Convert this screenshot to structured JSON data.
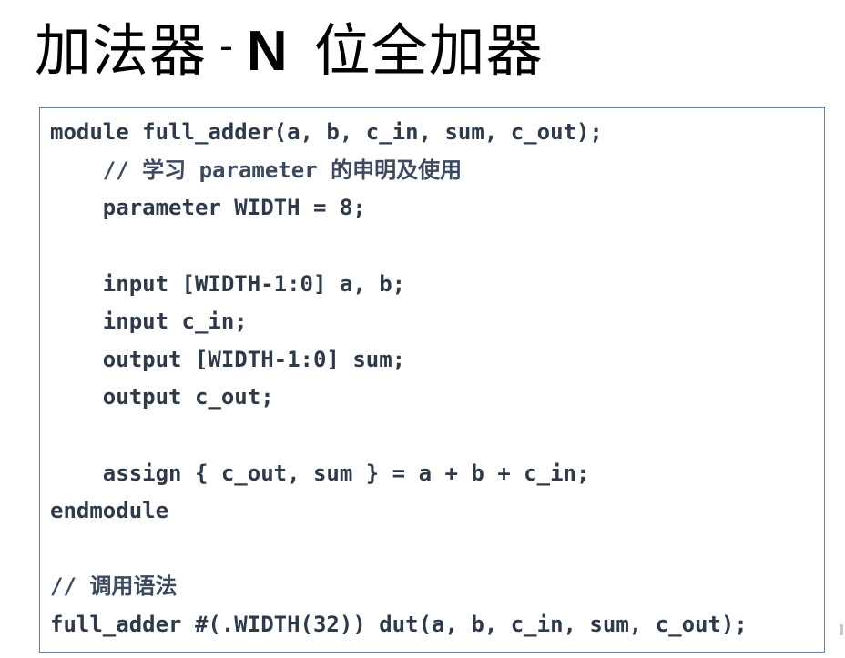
{
  "slide": {
    "title_part1": "加法器",
    "title_dash": "-",
    "title_part2": "N",
    "title_part3": "位全加器"
  },
  "code": {
    "lines": [
      "module full_adder(a, b, c_in, sum, c_out);",
      "    // 学习 parameter 的申明及使用",
      "    parameter WIDTH = 8;",
      "",
      "    input [WIDTH-1:0] a, b;",
      "    input c_in;",
      "    output [WIDTH-1:0] sum;",
      "    output c_out;",
      "",
      "    assign { c_out, sum } = a + b + c_in;",
      "endmodule",
      "",
      "// 调用语法",
      "full_adder #(.WIDTH(32)) dut(a, b, c_in, sum, c_out);"
    ]
  },
  "colors": {
    "code_text": "#2e3a4a",
    "border": "#5b7fa6"
  }
}
